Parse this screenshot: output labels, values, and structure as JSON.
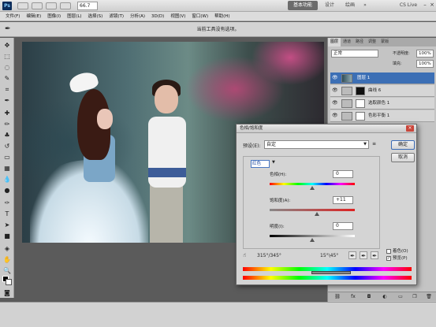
{
  "app": {
    "logo": "Ps",
    "zoom": "66.7",
    "workspace_tabs": [
      "基本功能",
      "设计",
      "绘画"
    ],
    "cslive": "CS Live"
  },
  "menu": [
    "文件(F)",
    "编辑(E)",
    "图像(I)",
    "图层(L)",
    "选择(S)",
    "滤镜(T)",
    "分析(A)",
    "3D(D)",
    "视图(V)",
    "窗口(W)",
    "帮助(H)"
  ],
  "options": {
    "hint": "当前工具没有选项。"
  },
  "layers_panel": {
    "tabs": [
      "图层",
      "通道",
      "路径",
      "调整",
      "蒙版"
    ],
    "blend_mode": "正常",
    "opacity_label": "不透明度:",
    "opacity_value": "100%",
    "fill_label": "填充:",
    "fill_value": "100%",
    "layers": [
      {
        "name": "图层 1",
        "selected": true
      },
      {
        "name": "曲线 6",
        "selected": false
      },
      {
        "name": "选取颜色 1",
        "selected": false
      },
      {
        "name": "色彩平衡 1",
        "selected": false
      }
    ]
  },
  "dialog": {
    "title": "色相/饱和度",
    "preset_label": "预设(E):",
    "preset_value": "自定",
    "ok": "确定",
    "cancel": "取消",
    "edit_target": "红色",
    "hue_label": "色相(H):",
    "hue_value": "0",
    "saturation_label": "饱和度(A):",
    "saturation_value": "+11",
    "lightness_label": "明度(I):",
    "lightness_value": "0",
    "range_left": "315°/345°",
    "range_right": "15°\\45°",
    "colorize_label": "着色(O)",
    "preview_label": "预览(P)",
    "colorize_checked": false,
    "preview_checked": true
  },
  "colors": {
    "accent": "#3c6fb5",
    "workspace_active": "#6c6c6c"
  }
}
